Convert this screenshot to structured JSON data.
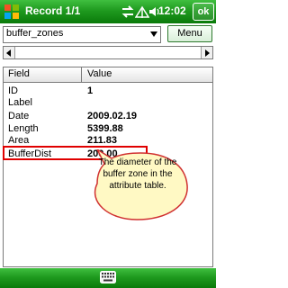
{
  "titlebar": {
    "title": "Record 1/1",
    "clock": "12:02",
    "ok_label": "ok"
  },
  "toolbar": {
    "layer_value": "buffer_zones",
    "menu_label": "Menu"
  },
  "table": {
    "headers": {
      "field": "Field",
      "value": "Value"
    },
    "rows": [
      {
        "field": "ID",
        "value": "1"
      },
      {
        "field": "Label",
        "value": ""
      },
      {
        "field": "Date",
        "value": "2009.02.19"
      },
      {
        "field": "Length",
        "value": "5399.88"
      },
      {
        "field": "Area",
        "value": "211.83"
      },
      {
        "field": "BufferDist",
        "value": "200.00"
      }
    ]
  },
  "callout": {
    "text": "The diameter of the buffer zone in the attribute table."
  },
  "colors": {
    "bar_green": "#1f9a1f",
    "highlight_red": "#e00000",
    "callout_fill": "#fff9c4"
  },
  "icons": [
    "windows-logo-icon",
    "sync-icon",
    "signal-icon",
    "volume-icon",
    "keyboard-icon"
  ]
}
